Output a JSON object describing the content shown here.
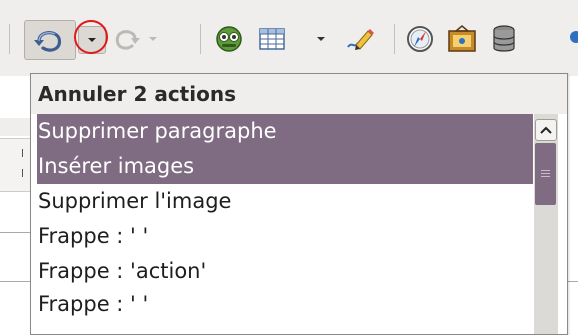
{
  "toolbar": {
    "icons": [
      "undo-icon",
      "dropdown-arrow-icon",
      "redo-icon",
      "dropdown-arrow-icon",
      "navigator-icon",
      "table-icon",
      "dropdown-arrow-icon",
      "draw-functions-icon",
      "navigator-compass-icon",
      "gallery-icon",
      "data-sources-icon"
    ],
    "accent_undo": "#4a6a99",
    "annotation_color": "#e01818"
  },
  "undo_menu": {
    "title": "Annuler 2 actions",
    "items": [
      {
        "label": "Supprimer paragraphe",
        "selected": true
      },
      {
        "label": "Insérer images",
        "selected": true
      },
      {
        "label": "Supprimer l'image",
        "selected": false
      },
      {
        "label": "Frappe : ' '",
        "selected": false
      },
      {
        "label": "Frappe : 'action'",
        "selected": false
      },
      {
        "label": "Frappe : ' '",
        "selected": false
      }
    ],
    "selection_color": "#7f6c82"
  }
}
